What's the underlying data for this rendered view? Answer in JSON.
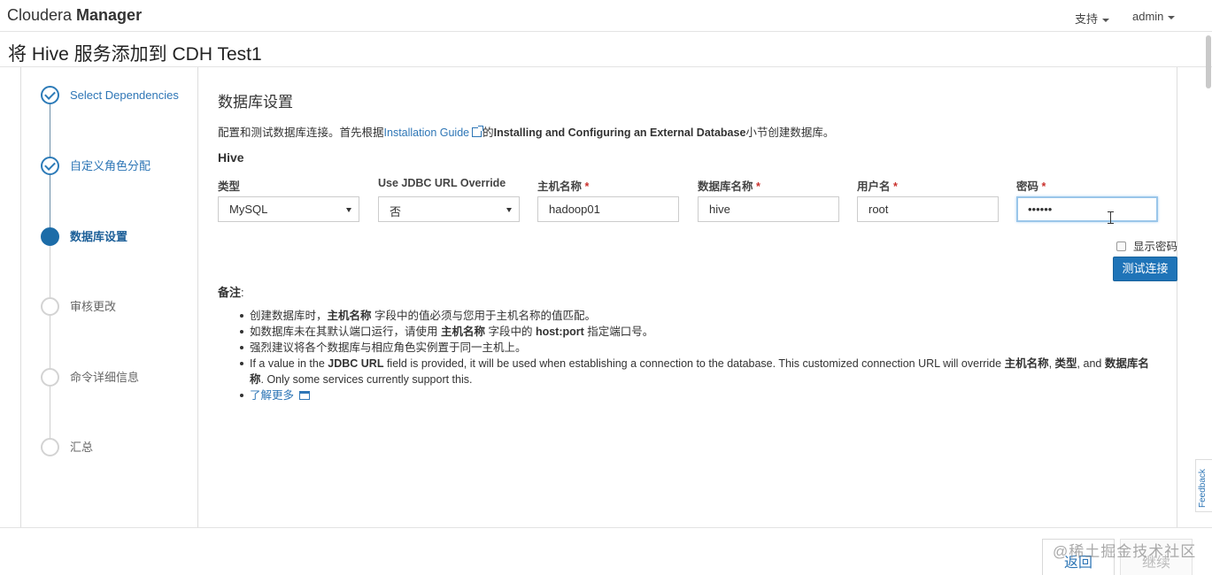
{
  "header": {
    "brand_light": "Cloudera ",
    "brand_bold": "Manager",
    "support_label": "支持",
    "user_label": "admin"
  },
  "page_title": "将 Hive 服务添加到 CDH Test1",
  "wizard": {
    "steps": [
      {
        "label": "Select Dependencies",
        "state": "done"
      },
      {
        "label": "自定义角色分配",
        "state": "done"
      },
      {
        "label": "数据库设置",
        "state": "current"
      },
      {
        "label": "审核更改",
        "state": "todo"
      },
      {
        "label": "命令详细信息",
        "state": "todo"
      },
      {
        "label": "汇总",
        "state": "todo"
      }
    ]
  },
  "section": {
    "title": "数据库设置",
    "intro_prefix": "配置和测试数据库连接。首先根据",
    "intro_link": "Installation Guide",
    "intro_mid": "的",
    "intro_bold": "Installing and Configuring an External Database",
    "intro_suffix": "小节创建数据库。",
    "service_heading": "Hive"
  },
  "form": {
    "type_label": "类型",
    "type_value": "MySQL",
    "jdbc_label": "Use JDBC URL Override",
    "jdbc_value": "否",
    "host_label": "主机名称",
    "host_value": "hadoop01",
    "dbname_label": "数据库名称",
    "dbname_value": "hive",
    "user_label": "用户名",
    "user_value": "root",
    "password_label": "密码",
    "password_value": "••••••",
    "required_mark": "*",
    "show_password_label": "显示密码",
    "test_button": "测试连接"
  },
  "notes": {
    "title": "备注",
    "colon": ":",
    "n1_a": "创建数据库时，",
    "n1_b": "主机名称",
    "n1_c": " 字段中的值必须与您用于主机名称的值匹配。",
    "n2_a": "如数据库未在其默认端口运行，请使用 ",
    "n2_b": "主机名称",
    "n2_c": " 字段中的 ",
    "n2_d": "host:port",
    "n2_e": " 指定端口号。",
    "n3": "强烈建议将各个数据库与相应角色实例置于同一主机上。",
    "n4_a": "If a value in the ",
    "n4_b": "JDBC URL",
    "n4_c": " field is provided, it will be used when establishing a connection to the database. This customized connection URL will override ",
    "n4_d": "主机名称",
    "n4_e": ", ",
    "n4_f": "类型",
    "n4_g": ", and ",
    "n4_h": "数据库名称",
    "n4_i": ". Only some services currently support this.",
    "learn_more": "了解更多"
  },
  "footer": {
    "back_button": "返回",
    "continue_button": "继续",
    "watermark": "@稀土掘金技术社区"
  },
  "feedback_label": "Feedback"
}
